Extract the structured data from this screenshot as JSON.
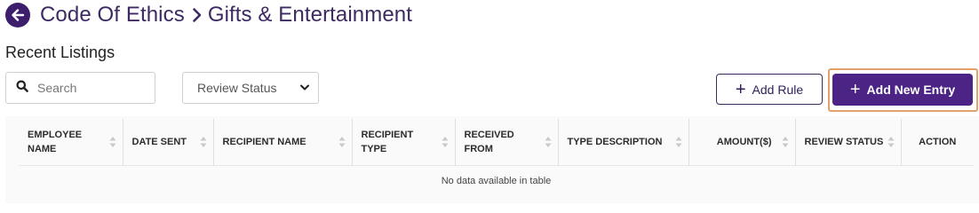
{
  "breadcrumb": {
    "parent": "Code Of Ethics",
    "current": "Gifts & Entertainment",
    "back_icon": "arrow-left-circle-icon",
    "separator_icon": "chevron-right-icon"
  },
  "section_title": "Recent Listings",
  "search": {
    "placeholder": "Search",
    "value": "",
    "icon": "search-icon"
  },
  "review_filter": {
    "selected": "Review Status",
    "icon": "chevron-down-icon"
  },
  "buttons": {
    "add_rule": "Add Rule",
    "add_new_entry": "Add New Entry",
    "plus": "+"
  },
  "table": {
    "columns": [
      {
        "label": "EMPLOYEE NAME"
      },
      {
        "label": "DATE SENT"
      },
      {
        "label": "RECIPIENT NAME"
      },
      {
        "label": "RECIPIENT TYPE"
      },
      {
        "label": "RECEIVED FROM"
      },
      {
        "label": "TYPE DESCRIPTION"
      },
      {
        "label": "AMOUNT($)"
      },
      {
        "label": "REVIEW STATUS"
      },
      {
        "label": "ACTION"
      }
    ],
    "empty_message": "No data available in table"
  },
  "colors": {
    "brand": "#4b2486",
    "breadcrumb_text": "#3d2a63",
    "focus_outline": "#e2a06a"
  }
}
